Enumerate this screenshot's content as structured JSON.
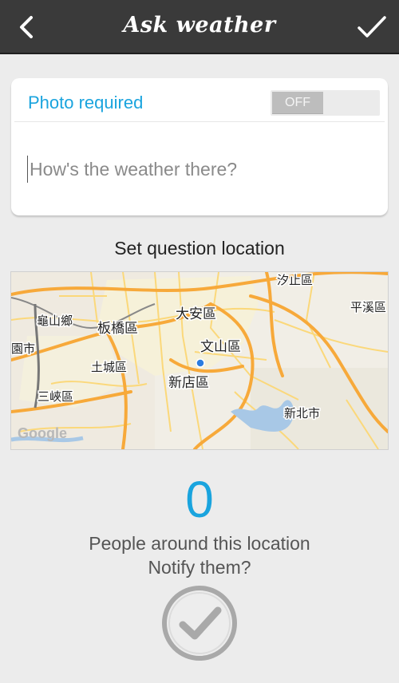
{
  "header": {
    "title": "Ask weather",
    "back_icon": "chevron-left-icon",
    "confirm_icon": "checkmark-icon"
  },
  "form": {
    "photo_label": "Photo required",
    "photo_toggle_state": "OFF",
    "question_placeholder": "How's the weather there?",
    "question_value": ""
  },
  "location": {
    "heading": "Set question location",
    "map_labels": {
      "xizhi": "汐止區",
      "pingxi": "平溪區",
      "guishan": "龜山鄉",
      "banqiao": "板橋區",
      "daan": "大安區",
      "wenshan": "文山區",
      "taoyuan": "園市",
      "tucheng": "土城區",
      "xindian": "新店區",
      "sanxia": "三峽區",
      "newtaipei": "新北市",
      "google": "Google"
    }
  },
  "people": {
    "count": "0",
    "label": "People around this location",
    "notify": "Notify them?",
    "notify_icon": "checkmark-circle-icon"
  },
  "colors": {
    "accent": "#1aa4de",
    "topbar": "#3a3a3a",
    "road_major": "#f7a93a",
    "road_minor": "#fbd87a"
  }
}
